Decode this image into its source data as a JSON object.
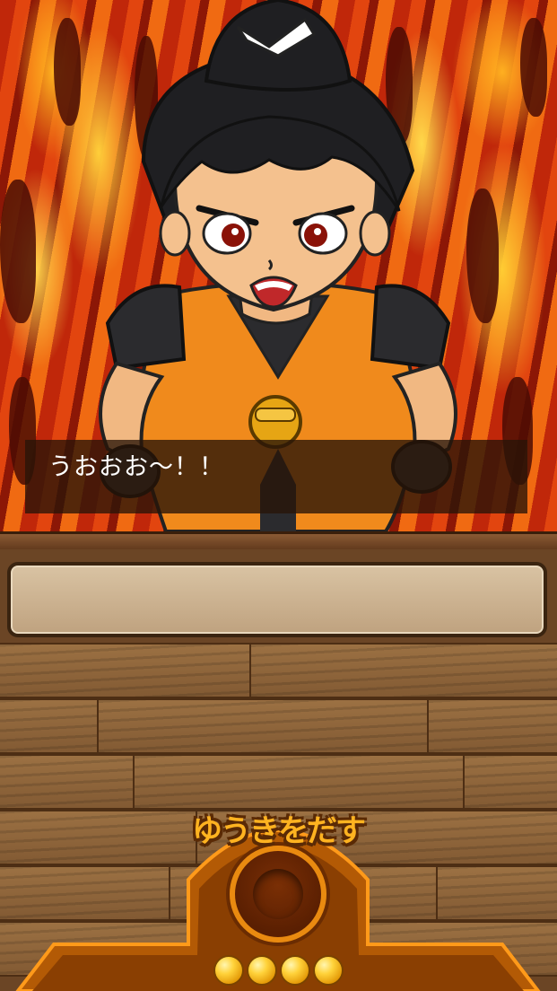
{
  "dialog": {
    "text": "うおおお〜！！"
  },
  "message_box": {
    "text": ""
  },
  "action_button": {
    "label": "ゆうきをだす",
    "icon": "empty-socket-icon"
  },
  "courage_orbs": {
    "count": 4,
    "color": "#ffd23a"
  },
  "colors": {
    "fire": "#e2450f",
    "wood": "#825a33",
    "button_accent": "#ffb320"
  }
}
